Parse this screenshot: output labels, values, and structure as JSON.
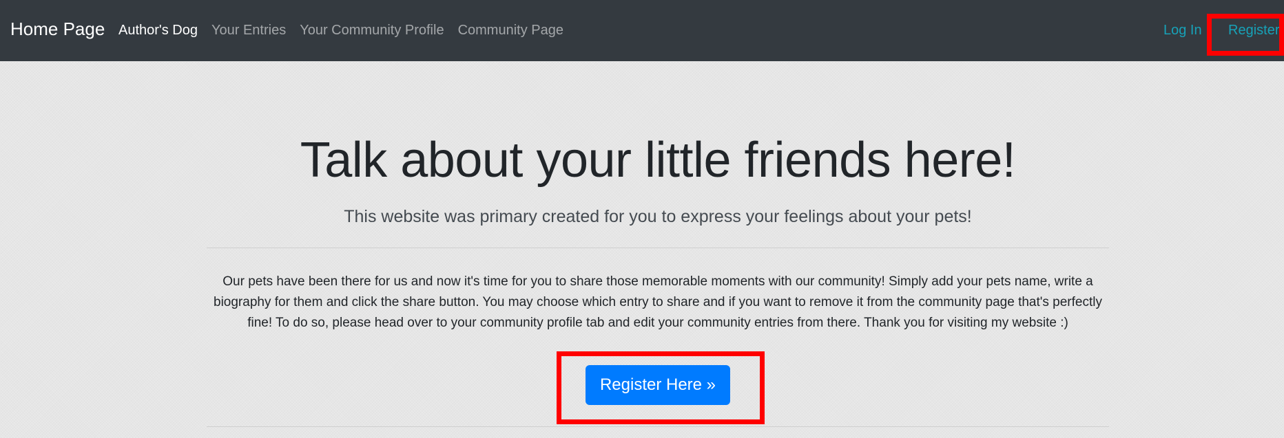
{
  "navbar": {
    "brand": "Home Page",
    "links": [
      {
        "label": "Author's Dog",
        "active": true
      },
      {
        "label": "Your Entries",
        "active": false
      },
      {
        "label": "Your Community Profile",
        "active": false
      },
      {
        "label": "Community Page",
        "active": false
      }
    ],
    "right": {
      "login": "Log In",
      "register": "Register"
    }
  },
  "hero": {
    "title": "Talk about your little friends here!",
    "lead": "This website was primary created for you to express your feelings about your pets!",
    "body": "Our pets have been there for us and now it's time for you to share those memorable moments with our community! Simply add your pets name, write a biography for them and click the share button. You may choose which entry to share and if you want to remove it from the community page that's perfectly fine! To do so, please head over to your community profile tab and edit your community entries from there. Thank you for visiting my website :)",
    "button": "Register Here »"
  },
  "colors": {
    "navbar_bg": "#343a40",
    "accent_link": "#17a2b8",
    "primary_button": "#007bff",
    "highlight": "#ff0000"
  }
}
